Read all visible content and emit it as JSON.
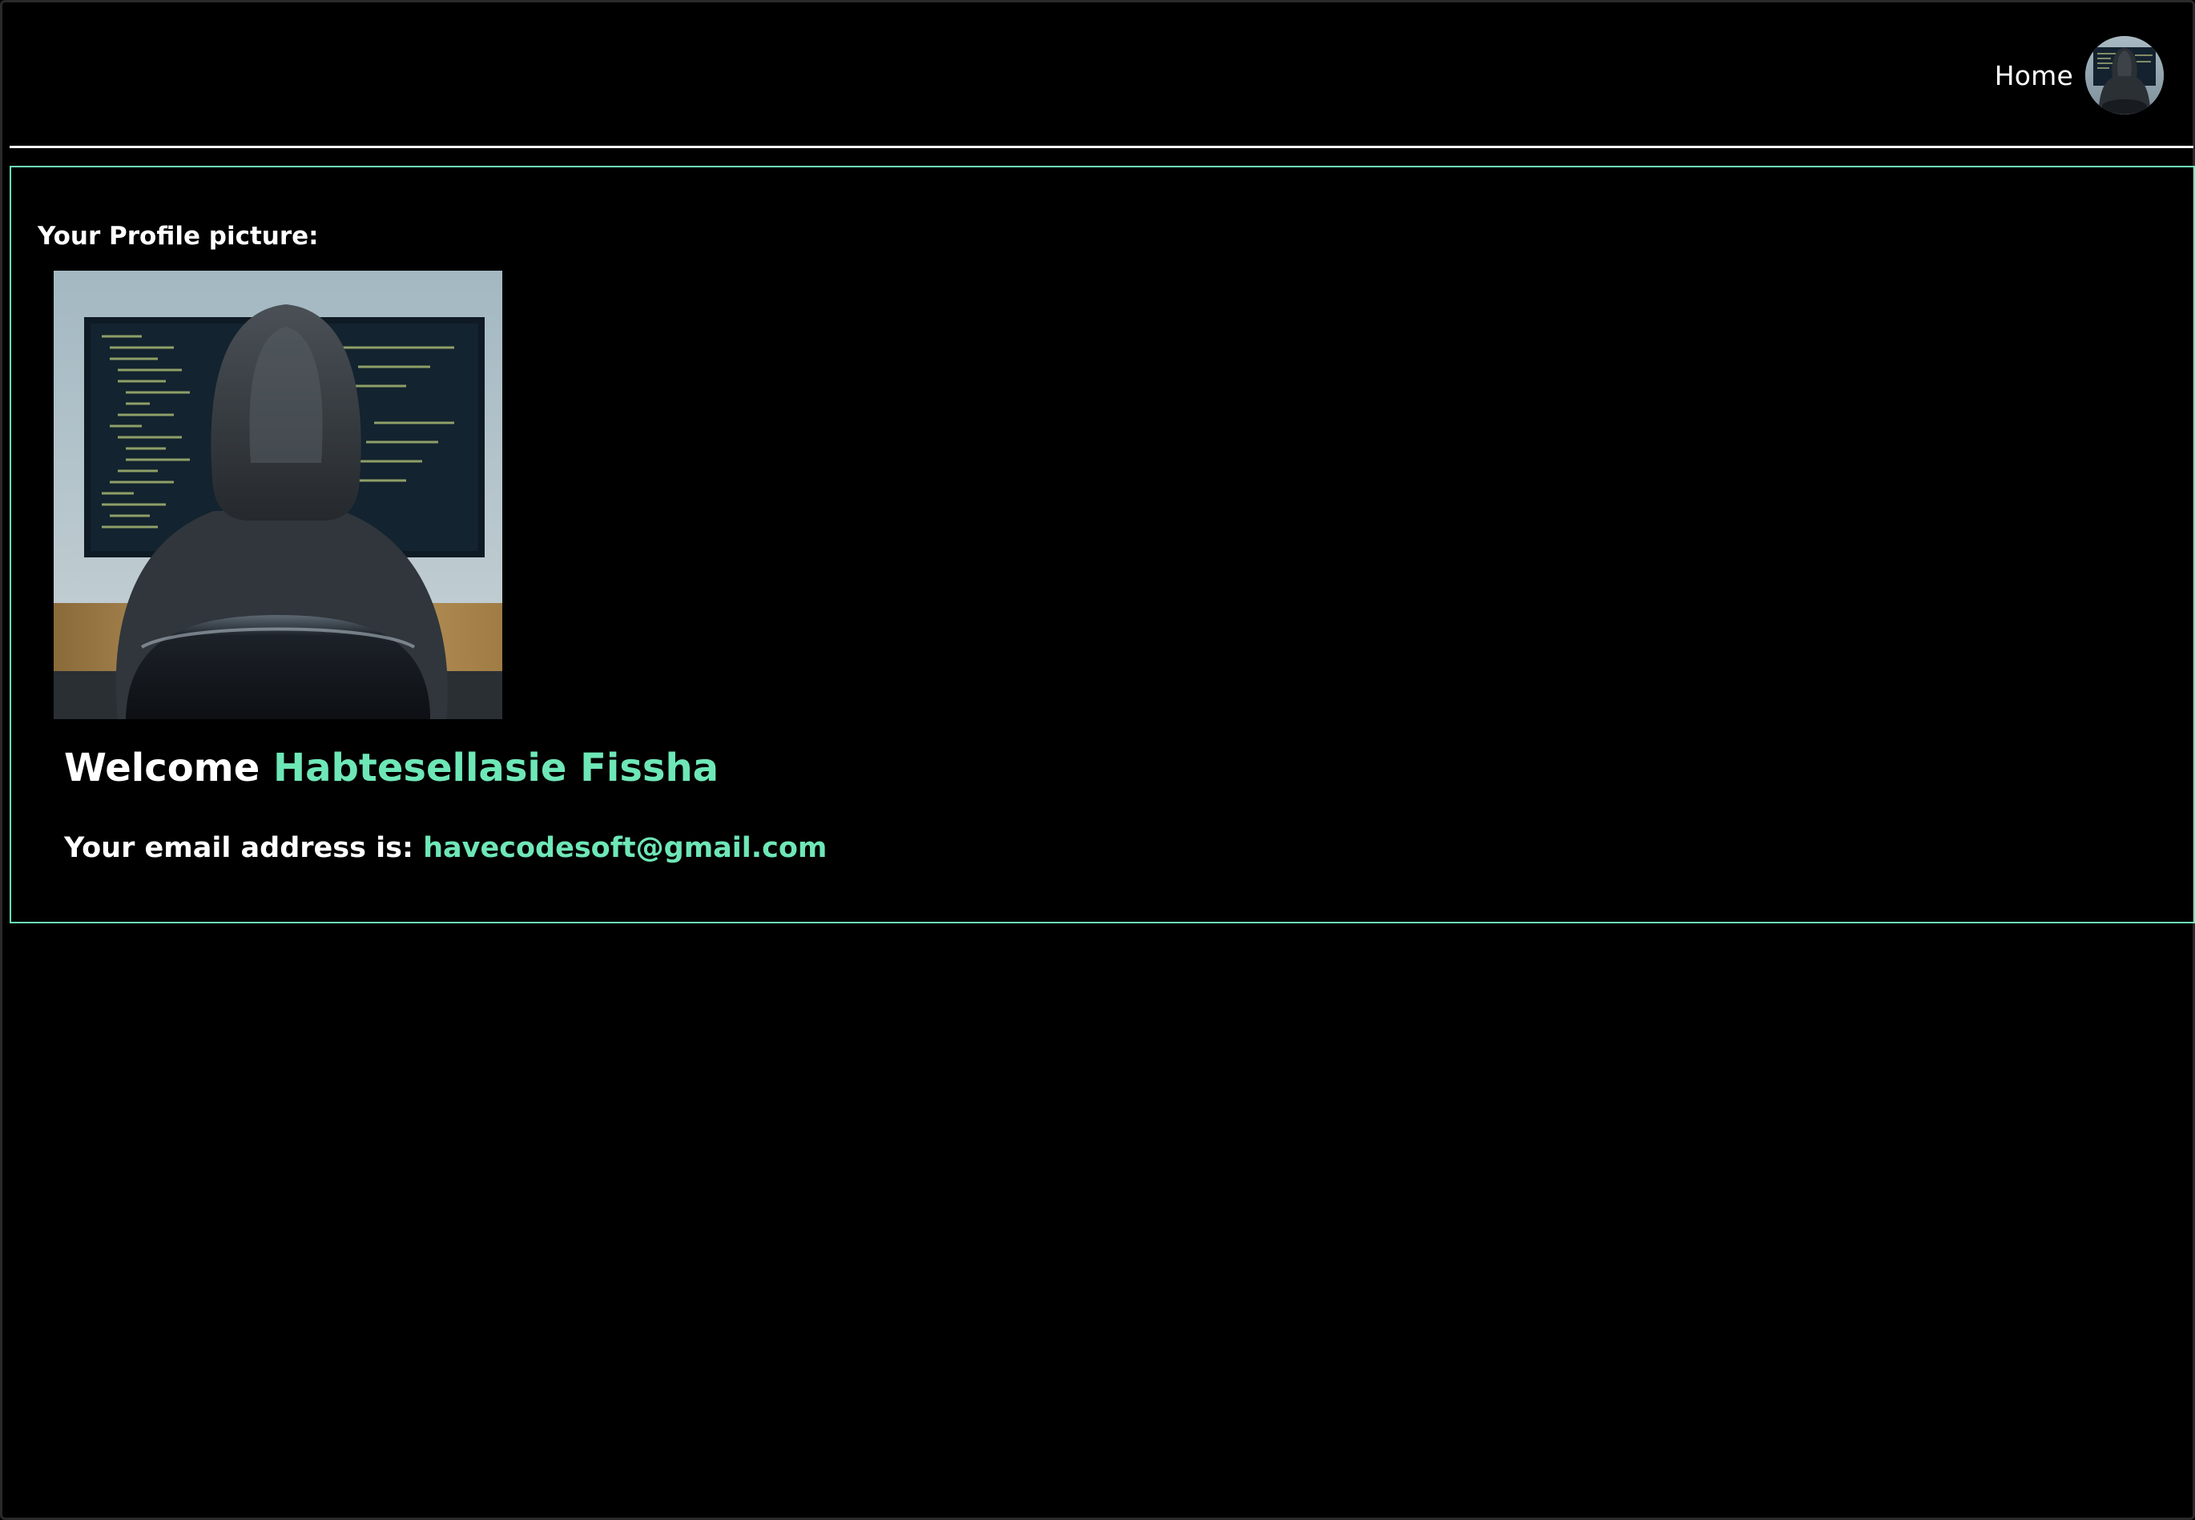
{
  "nav": {
    "home_label": "Home"
  },
  "profile": {
    "picture_label": "Your Profile picture:",
    "welcome_prefix": "Welcome",
    "user_name": "Habtesellasie Fissha",
    "email_prefix": "Your email address is:",
    "email": "havecodesoft@gmail.com"
  },
  "colors": {
    "background": "#000000",
    "accent": "#6ee7b7",
    "text": "#ffffff",
    "divider": "#ffffff"
  },
  "icons": {
    "avatar": "hooded-coder-avatar-icon",
    "profile_picture": "hooded-coder-image"
  }
}
